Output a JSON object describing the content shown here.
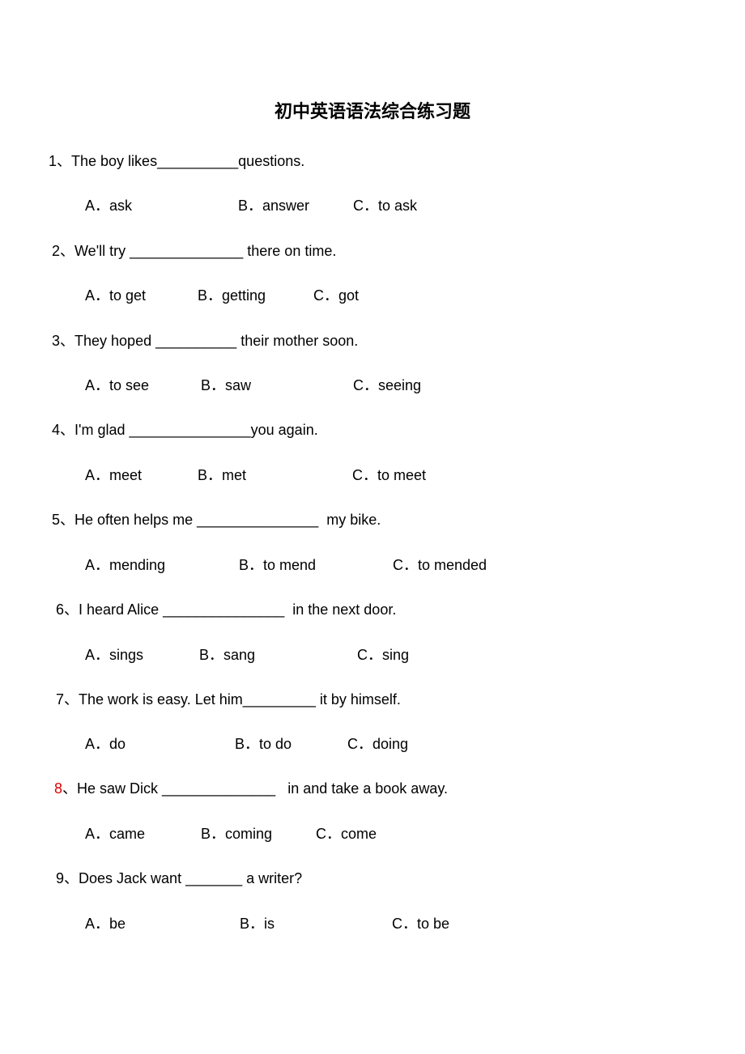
{
  "title": "初中英语语法综合练习题",
  "questions": [
    {
      "num": "1",
      "sep": "、",
      "text": "The boy likes__________questions.",
      "options": [
        "A．ask",
        "B．answer",
        "C．to ask"
      ]
    },
    {
      "num": "2",
      "sep": "、",
      "text": "We'll try ______________ there on time.",
      "options": [
        "A．to get",
        "B．getting",
        "C．got"
      ]
    },
    {
      "num": "3",
      "sep": "、",
      "text": "They hoped __________ their mother soon.",
      "options": [
        "A．to see",
        "B．saw",
        "C．seeing"
      ]
    },
    {
      "num": "4",
      "sep": "、",
      "text": "I'm glad _______________you again.",
      "options": [
        "A．meet",
        "B．met",
        "C．to meet"
      ]
    },
    {
      "num": "5",
      "sep": "、",
      "text": "He often helps me _______________  my bike.",
      "options": [
        "A．mending",
        "B．to mend",
        "C．to mended"
      ]
    },
    {
      "num": "6",
      "sep": "、",
      "text": "I heard Alice _______________  in the next door.",
      "options": [
        "A．sings",
        "B．sang",
        "C．sing"
      ]
    },
    {
      "num": "7",
      "sep": "、",
      "text": "The work is easy. Let him_________ it by himself.",
      "options": [
        "A．do",
        "B．to do",
        "C．doing"
      ]
    },
    {
      "num": "8",
      "sep": "、",
      "text": "He saw Dick ______________   in and take a book away.",
      "options": [
        "A．came",
        "B．coming",
        "C．come"
      ]
    },
    {
      "num": "9",
      "sep": "、",
      "text": "Does Jack want _______ a writer?",
      "options": [
        "A．be",
        "B．is",
        "C．to be"
      ]
    }
  ],
  "colors": {
    "highlight_number": "#e00000"
  }
}
